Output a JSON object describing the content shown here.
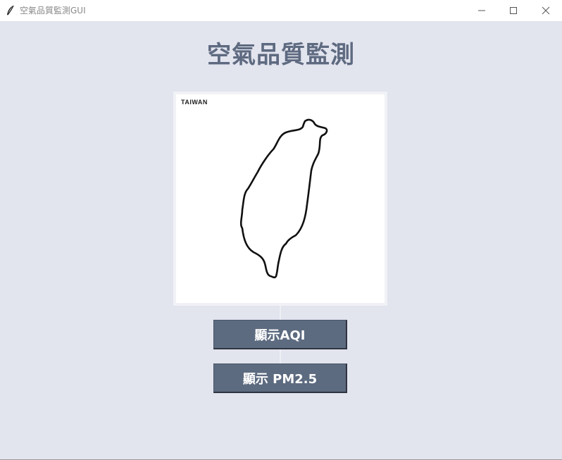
{
  "window": {
    "title": "空氣品質監測GUI"
  },
  "header": {
    "title": "空氣品質監測"
  },
  "map": {
    "label": "TAIWAN"
  },
  "buttons": {
    "aqi_label": "顯示AQI",
    "pm25_label": "顯示 PM2.5"
  },
  "colors": {
    "background": "#e2e4ee",
    "heading": "#5e6a80",
    "button": "#5d6b80"
  },
  "icons": {
    "app": "feather-icon",
    "minimize": "minimize-icon",
    "maximize": "maximize-icon",
    "close": "close-icon"
  }
}
